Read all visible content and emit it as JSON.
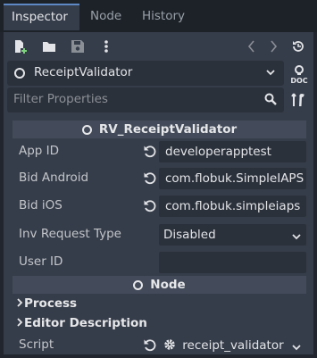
{
  "tabs": [
    {
      "label": "Inspector",
      "active": true
    },
    {
      "label": "Node",
      "active": false
    },
    {
      "label": "History",
      "active": false
    }
  ],
  "toolbar": {
    "icons": [
      "new-resource-icon",
      "open-folder-icon",
      "save-icon",
      "more-vert-icon",
      "history-back-icon",
      "history-forward-icon",
      "object-history-icon"
    ]
  },
  "node_selector": {
    "value": "ReceiptValidator"
  },
  "doc_button": {
    "label": "DOC"
  },
  "filter": {
    "placeholder": "Filter Properties"
  },
  "sections": {
    "script_class": {
      "title": "RV_ReceiptValidator"
    },
    "node": {
      "title": "Node"
    }
  },
  "properties": [
    {
      "label": "App ID",
      "value": "developerapptest",
      "revertable": true,
      "type": "text"
    },
    {
      "label": "Bid Android",
      "value": "com.flobuk.SimpleIAPS",
      "revertable": true,
      "type": "text"
    },
    {
      "label": "Bid iOS",
      "value": "com.flobuk.simpleiaps",
      "revertable": true,
      "type": "text"
    },
    {
      "label": "Inv Request Type",
      "value": "Disabled",
      "revertable": false,
      "type": "dropdown"
    },
    {
      "label": "User ID",
      "value": "",
      "revertable": false,
      "type": "text"
    }
  ],
  "groups": [
    {
      "label": "Process"
    },
    {
      "label": "Editor Description"
    }
  ],
  "script_property": {
    "label": "Script",
    "value": "receipt_validator"
  },
  "colors": {
    "accent": "#5d88c4",
    "panel": "#363d4a",
    "field": "#2b313b",
    "header": "#434b5a"
  }
}
